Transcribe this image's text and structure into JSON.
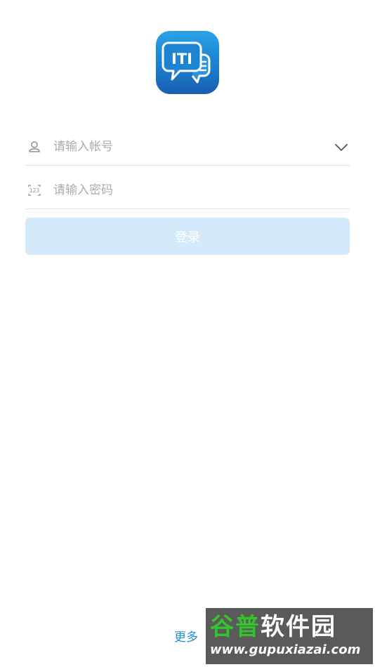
{
  "logo": {
    "icon": "chat-bubbles-logo-icon",
    "mark_text": "ITI"
  },
  "login_form": {
    "account": {
      "icon": "user-icon",
      "placeholder": "请输入帐号",
      "value": "",
      "dropdown_icon": "chevron-down-icon"
    },
    "password": {
      "icon": "numeric-keypad-icon",
      "icon_text": "123",
      "placeholder": "请输入密码",
      "value": ""
    },
    "submit_label": "登录"
  },
  "footer": {
    "more_label": "更多"
  },
  "watermark": {
    "title_green": "谷普",
    "title_white": "软件园",
    "url": "www.gupuxiazai.com"
  },
  "colors": {
    "accent": "#1f8fd6",
    "button_disabled_bg": "#d3eafb",
    "logo_gradient_top": "#2aa2e6",
    "logo_gradient_bottom": "#1a5fae"
  }
}
